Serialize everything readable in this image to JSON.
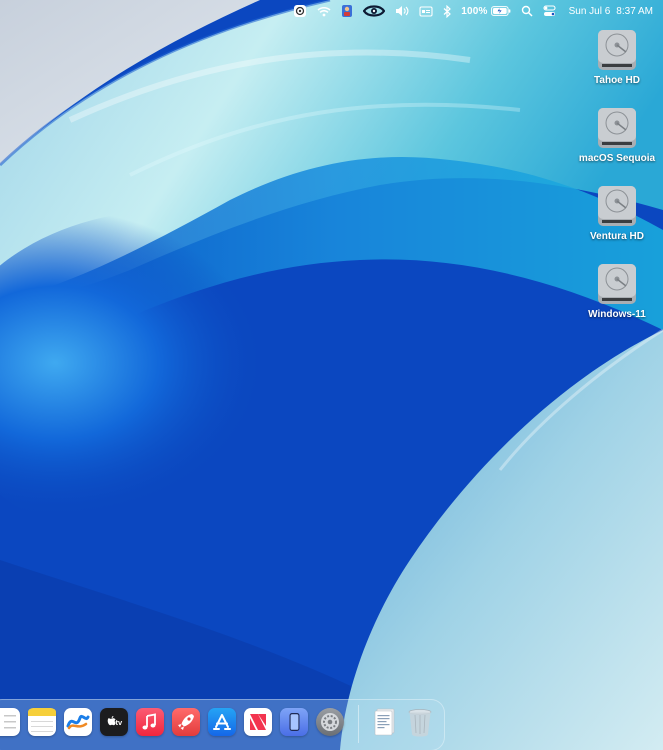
{
  "menubar": {
    "battery_percent": "100%",
    "clock_date": "Sun Jul 6",
    "clock_time": "8:37 AM",
    "icons": [
      "system-settings-icon",
      "wifi-icon",
      "app-icon",
      "eye-icon",
      "volume-icon",
      "keyboard-icon",
      "bluetooth-icon",
      "battery-icon",
      "spotlight-icon",
      "control-center-icon"
    ]
  },
  "desktop": {
    "drives": [
      {
        "label": "Tahoe HD"
      },
      {
        "label": "macOS Sequoia"
      },
      {
        "label": "Ventura HD"
      },
      {
        "label": "Windows-11"
      }
    ]
  },
  "dock": {
    "apps": [
      "reminders-icon",
      "notes-icon",
      "freeform-icon",
      "apple-tv-icon",
      "music-icon",
      "launchpad-icon",
      "app-store-icon",
      "news-icon",
      "iphone-mirroring-icon",
      "system-settings-icon"
    ],
    "right": [
      "documents-stack-icon",
      "trash-icon"
    ],
    "tv_label": "tv"
  },
  "colors": {
    "menubar_text": "#ffffff",
    "wallpaper_main": "#0d56d6"
  }
}
